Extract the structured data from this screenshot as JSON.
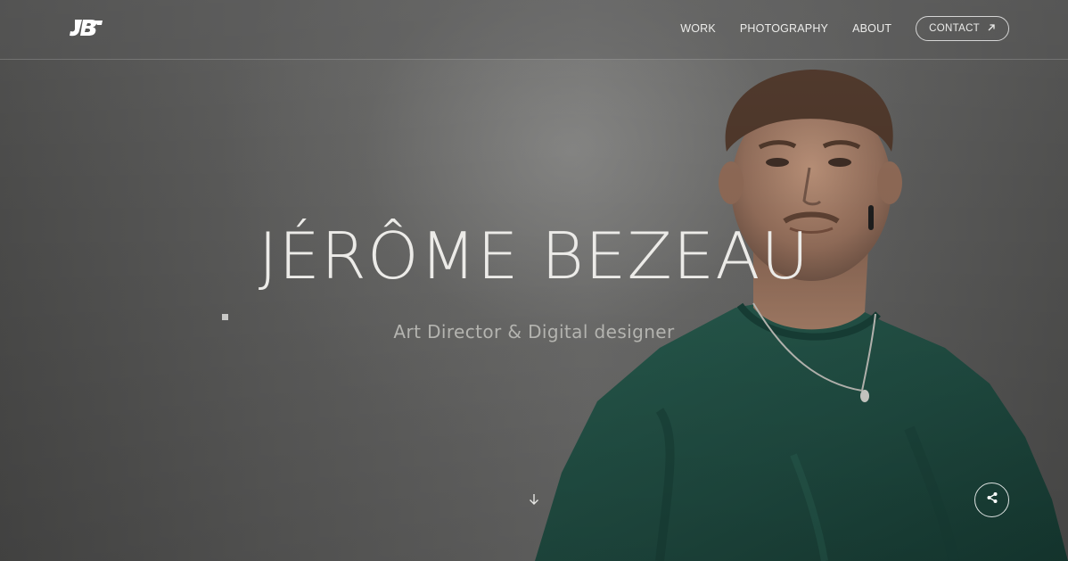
{
  "header": {
    "logo_text": "JB",
    "nav": [
      {
        "label": "WORK"
      },
      {
        "label": "PHOTOGRAPHY"
      },
      {
        "label": "ABOUT"
      }
    ],
    "contact_label": "CONTACT"
  },
  "hero": {
    "title": "JÉRÔME BEZEAU",
    "subtitle": "Art Director & Digital designer"
  },
  "icons": {
    "contact": "arrow-up-right-icon",
    "scroll": "arrow-down-icon",
    "share": "share-icon"
  },
  "colors": {
    "background": "#5d5d5c",
    "text": "#ecebe8",
    "subtitle": "#b4b4b0",
    "shirt": "#1f4a40"
  }
}
